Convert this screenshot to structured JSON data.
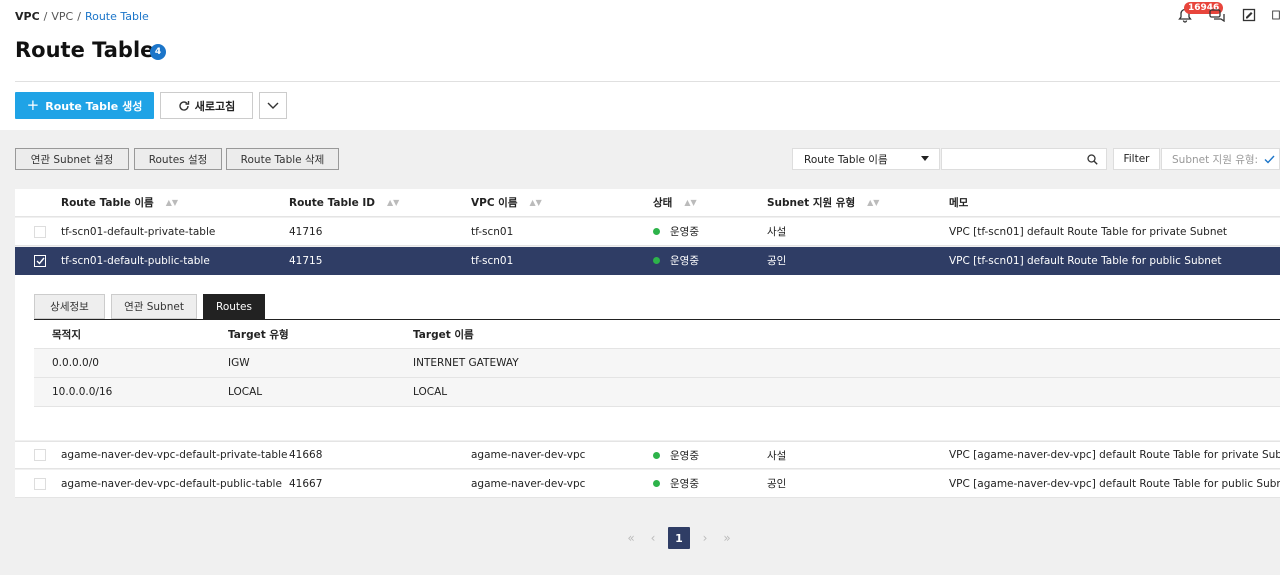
{
  "breadcrumb": {
    "root": "VPC",
    "sep1": "/",
    "parent": "VPC",
    "sep2": "/",
    "current": "Route Table"
  },
  "header": {
    "notification_count": "16946",
    "icons": [
      "bell-icon",
      "chat-icon",
      "edit-note-icon",
      "document-icon"
    ]
  },
  "page": {
    "title": "Route Table",
    "count": "4"
  },
  "toolbar": {
    "create_label": "Route Table 생성",
    "refresh_label": "새로고침"
  },
  "actions": {
    "subnet_setting": "연관 Subnet 설정",
    "routes_setting": "Routes 설정",
    "delete": "Route Table 삭제"
  },
  "filter": {
    "field_selected": "Route Table 이름",
    "search_value": "",
    "filter_label": "Filter",
    "subnet_type_label": "Subnet 지원 유형:"
  },
  "table": {
    "columns": [
      "Route Table 이름",
      "Route Table ID",
      "VPC 이름",
      "상태",
      "Subnet 지원 유형",
      "메모"
    ],
    "rows": [
      {
        "name": "tf-scn01-default-private-table",
        "id": "41716",
        "vpc": "tf-scn01",
        "status": "운영중",
        "subnet_type": "사설",
        "memo": "VPC [tf-scn01] default Route Table for private Subnet",
        "selected": false
      },
      {
        "name": "tf-scn01-default-public-table",
        "id": "41715",
        "vpc": "tf-scn01",
        "status": "운영중",
        "subnet_type": "공인",
        "memo": "VPC [tf-scn01] default Route Table for public Subnet",
        "selected": true
      },
      {
        "name": "agame-naver-dev-vpc-default-private-table",
        "id": "41668",
        "vpc": "agame-naver-dev-vpc",
        "status": "운영중",
        "subnet_type": "사설",
        "memo": "VPC [agame-naver-dev-vpc] default Route Table for private Subnet",
        "selected": false
      },
      {
        "name": "agame-naver-dev-vpc-default-public-table",
        "id": "41667",
        "vpc": "agame-naver-dev-vpc",
        "status": "운영중",
        "subnet_type": "공인",
        "memo": "VPC [agame-naver-dev-vpc] default Route Table for public Subnet",
        "selected": false
      }
    ]
  },
  "detail": {
    "tabs": [
      "상세정보",
      "연관 Subnet",
      "Routes"
    ],
    "active_tab": "Routes",
    "routes_columns": [
      "목적지",
      "Target 유형",
      "Target 이름"
    ],
    "routes": [
      {
        "destination": "0.0.0.0/0",
        "target_type": "IGW",
        "target_name": "INTERNET GATEWAY"
      },
      {
        "destination": "10.0.0.0/16",
        "target_type": "LOCAL",
        "target_name": "LOCAL"
      }
    ]
  },
  "pagination": {
    "current_page": "1"
  },
  "colors": {
    "primary": "#1fa3e6",
    "selected_row": "#2f3d65",
    "status_green": "#2db34a",
    "badge_red": "#e8453c"
  }
}
